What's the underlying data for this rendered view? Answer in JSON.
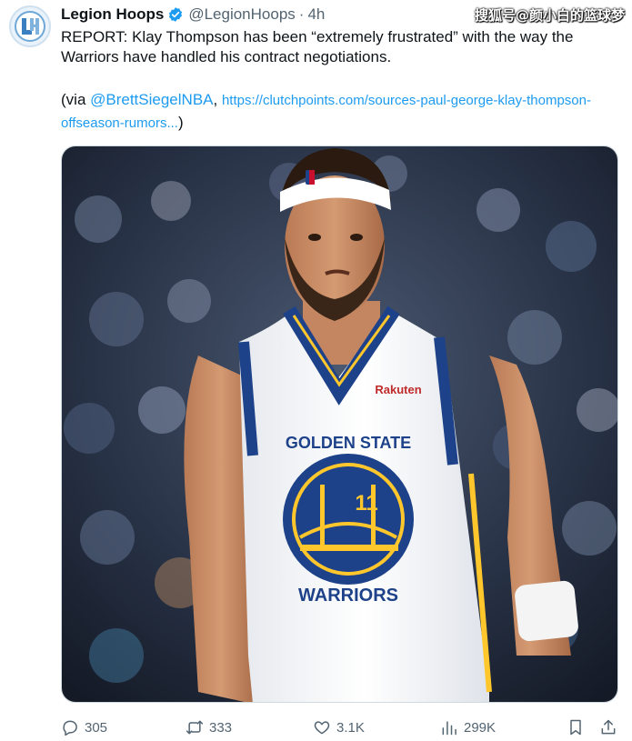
{
  "tweet": {
    "author_name": "Legion Hoops",
    "handle": "@LegionHoops",
    "separator": "·",
    "time": "4h",
    "text": "REPORT: Klay Thompson has been “extremely frustrated” with the way the Warriors have handled his contract negotiations.",
    "via_prefix": "(via ",
    "via_mention": "@BrettSiegelNBA",
    "via_comma": ", ",
    "via_url": "https://clutchpoints.com/sources-paul-george-klay-thompson-offseason-rumors...",
    "via_suffix": ")"
  },
  "watermark": "搜狐号@颜小白的篮球梦",
  "photo": {
    "jersey_top": "GOLDEN STATE",
    "jersey_bottom": "WARRIORS",
    "jersey_number": "11",
    "sponsor": "Rakuten"
  },
  "actions": {
    "replies": "305",
    "retweets": "333",
    "likes": "3.1K",
    "views": "299K"
  },
  "colors": {
    "accent": "#1d9bf0",
    "muted": "#536471",
    "warriors_blue": "#1d428a",
    "warriors_gold": "#ffc72c"
  }
}
